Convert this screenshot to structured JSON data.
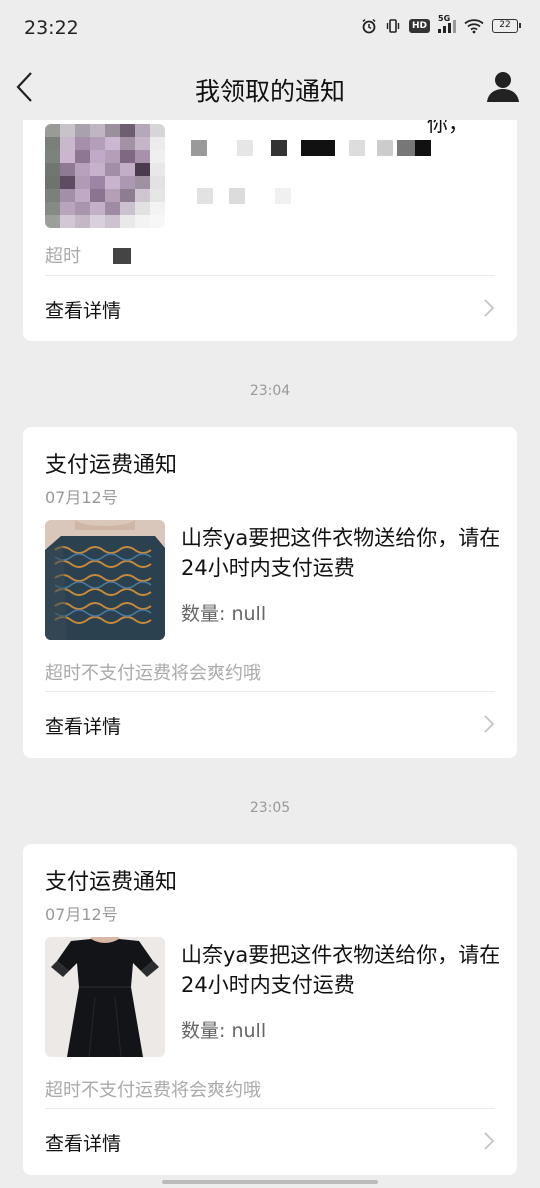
{
  "status_bar": {
    "time": "23:22",
    "network": "5G",
    "hd": "HD",
    "battery": "22"
  },
  "nav": {
    "title": "我领取的通知",
    "back_icon": "chevron-left-icon",
    "profile_icon": "user-icon"
  },
  "partial_card": {
    "message_fragment": "你，",
    "warning_fragment": "超时",
    "detail_label": "查看详情"
  },
  "timestamps": [
    "23:04",
    "23:05"
  ],
  "notifications": [
    {
      "title": "支付运费通知",
      "date": "07月12号",
      "message": "山奈ya要把这件衣物送给你，请在24小时内支付运费",
      "qty_label": "数量: ",
      "qty_value": "null",
      "warning": "超时不支付运费将会爽约哦",
      "detail_label": "查看详情"
    },
    {
      "title": "支付运费通知",
      "date": "07月12号",
      "message": "山奈ya要把这件衣物送给你，请在24小时内支付运费",
      "qty_label": "数量: ",
      "qty_value": "null",
      "warning": "超时不支付运费将会爽约哦",
      "detail_label": "查看详情"
    }
  ],
  "colors": {
    "background": "#ededed",
    "card": "#ffffff",
    "muted_text": "#999999",
    "warning_text": "#aaaaaa"
  }
}
